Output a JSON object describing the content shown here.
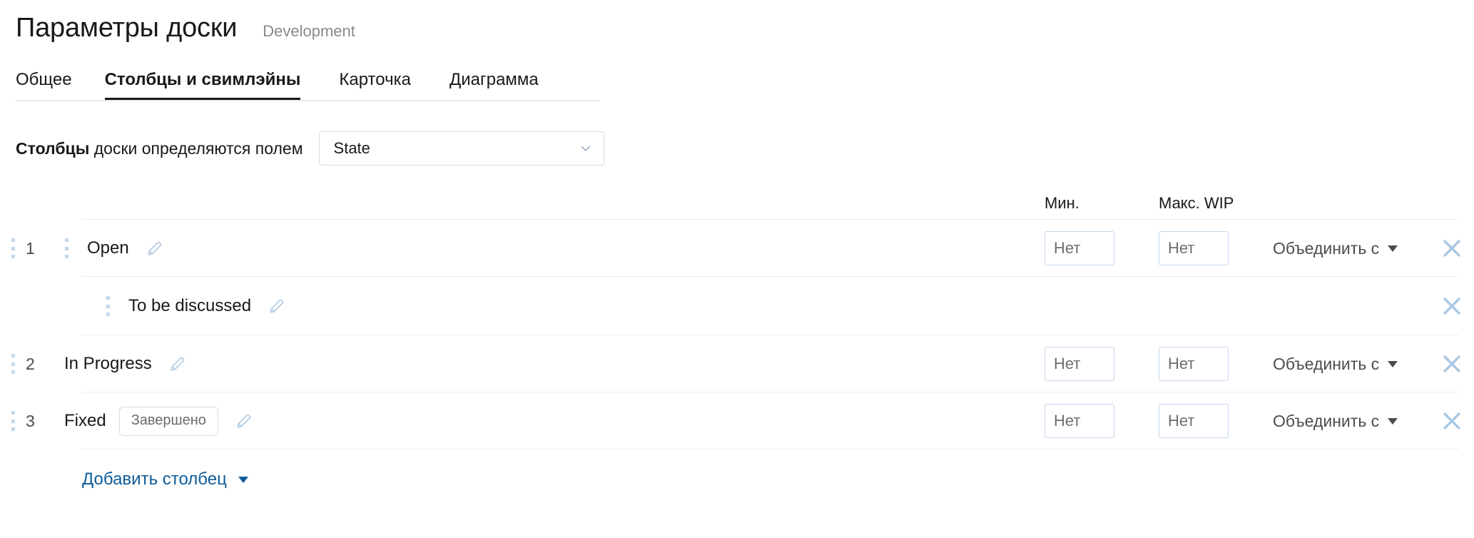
{
  "header": {
    "title": "Параметры доски",
    "subtitle": "Development"
  },
  "tabs": [
    {
      "label": "Общее",
      "active": false
    },
    {
      "label": "Столбцы и свимлэйны",
      "active": true
    },
    {
      "label": "Карточка",
      "active": false
    },
    {
      "label": "Диаграмма",
      "active": false
    }
  ],
  "field_selector": {
    "label_bold": "Столбцы",
    "label_rest": " доски определяются полем",
    "selected_value": "State",
    "chevron_icon": "chevron-down-icon"
  },
  "table": {
    "headers": {
      "min": "Мин.",
      "max_wip": "Макс. WIP"
    },
    "rows": [
      {
        "index": "1",
        "name": "Open",
        "badge": "",
        "min_placeholder": "Нет",
        "min_value": "",
        "max_placeholder": "Нет",
        "max_value": "",
        "merge_label": "Объединить с",
        "is_sub": false,
        "has_controls": true
      },
      {
        "index": "",
        "name": "To be discussed",
        "badge": "",
        "min_placeholder": "",
        "min_value": "",
        "max_placeholder": "",
        "max_value": "",
        "merge_label": "",
        "is_sub": true,
        "has_controls": false
      },
      {
        "index": "2",
        "name": "In Progress",
        "badge": "",
        "min_placeholder": "Нет",
        "min_value": "",
        "max_placeholder": "Нет",
        "max_value": "",
        "merge_label": "Объединить с",
        "is_sub": false,
        "has_controls": true
      },
      {
        "index": "3",
        "name": "Fixed",
        "badge": "Завершено",
        "min_placeholder": "Нет",
        "min_value": "",
        "max_placeholder": "Нет",
        "max_value": "",
        "merge_label": "Объединить с",
        "is_sub": false,
        "has_controls": true
      }
    ]
  },
  "add_column": {
    "label": "Добавить столбец",
    "caret_icon": "caret-down-icon"
  },
  "colors": {
    "link": "#0f5c99",
    "accent_border": "#c3d6ea",
    "close_icon": "#a8c7e3",
    "pencil_icon": "#b9cfe4",
    "text": "#19191c",
    "muted": "#8a8a8a"
  }
}
